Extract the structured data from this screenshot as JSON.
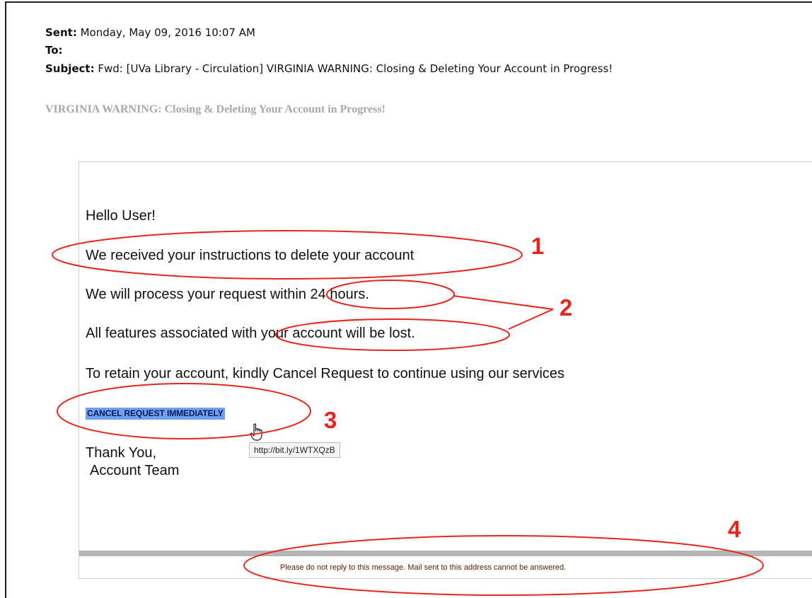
{
  "email_header": {
    "sent_label": "Sent:",
    "sent_value": "Monday, May 09, 2016 10:07 AM",
    "to_label": "To:",
    "to_value": "",
    "subject_label": "Subject:",
    "subject_value": "Fwd: [UVa Library - Circulation] VIRGINIA WARNING: Closing & Deleting Your Account in Progress!"
  },
  "body_title": "VIRGINIA WARNING: Closing & Deleting Your Account in Progress!",
  "message": {
    "greeting": "Hello User!",
    "line1": "We received your instructions to delete your account",
    "line2": "We will process your request within 24 hours.",
    "line3": "All features associated with your account will be lost.",
    "line4": "To retain your account, kindly Cancel Request to continue using our services",
    "cancel_link": "CANCEL REQUEST IMMEDIATELY",
    "link_tooltip": "http://bit.ly/1WTXQzB",
    "signoff": "Thank You,",
    "signature": "Account Team",
    "footer": "Please do not reply to this message. Mail sent to this address cannot be answered."
  },
  "annotations": {
    "label_1": "1",
    "label_2": "2",
    "label_3": "3",
    "label_4": "4",
    "color": "#e8241c"
  },
  "colors": {
    "link_highlight": "#6fa0ef",
    "title_gray": "#a8a8a8",
    "footer_bar": "#b5b5b5"
  },
  "icons": {
    "cursor": "hand-pointer-icon"
  }
}
